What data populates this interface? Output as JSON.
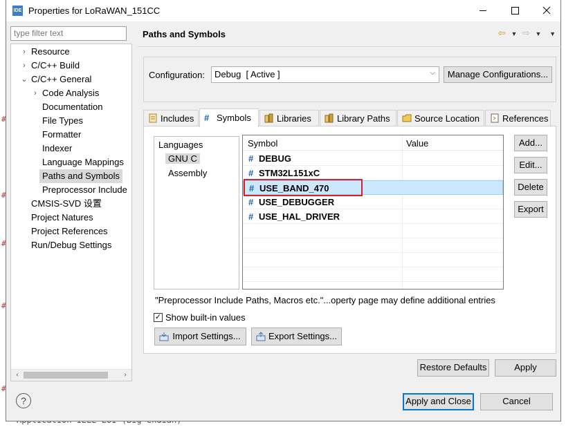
{
  "window": {
    "title": "Properties for LoRaWAN_151CC",
    "icon_text": "IDE",
    "controls": [
      "minimize-icon",
      "maximize-icon",
      "close-icon"
    ]
  },
  "background": {
    "bottom_text": "Application IEEE-EUI (Big endian)"
  },
  "filter": {
    "placeholder": "type filter text"
  },
  "tree": {
    "items": [
      {
        "label": "Resource",
        "level": 1,
        "arrow": "›"
      },
      {
        "label": "C/C++ Build",
        "level": 1,
        "arrow": "›"
      },
      {
        "label": "C/C++ General",
        "level": 1,
        "arrow": "⌄"
      },
      {
        "label": "Code Analysis",
        "level": 2,
        "arrow": "›"
      },
      {
        "label": "Documentation",
        "level": 2,
        "arrow": ""
      },
      {
        "label": "File Types",
        "level": 2,
        "arrow": ""
      },
      {
        "label": "Formatter",
        "level": 2,
        "arrow": ""
      },
      {
        "label": "Indexer",
        "level": 2,
        "arrow": ""
      },
      {
        "label": "Language Mappings",
        "level": 2,
        "arrow": ""
      },
      {
        "label": "Paths and Symbols",
        "level": 2,
        "arrow": "",
        "selected": true
      },
      {
        "label": "Preprocessor Include",
        "level": 2,
        "arrow": ""
      },
      {
        "label": "CMSIS-SVD 设置",
        "level": 1,
        "arrow": ""
      },
      {
        "label": "Project Natures",
        "level": 1,
        "arrow": ""
      },
      {
        "label": "Project References",
        "level": 1,
        "arrow": ""
      },
      {
        "label": "Run/Debug Settings",
        "level": 1,
        "arrow": ""
      }
    ]
  },
  "header": {
    "title": "Paths and Symbols"
  },
  "config": {
    "label": "Configuration:",
    "value": "Debug  [ Active ]",
    "manage_label": "Manage Configurations..."
  },
  "tabs": [
    {
      "label": "Includes",
      "icon": "includes-icon"
    },
    {
      "label": "Symbols",
      "icon": "hash-icon",
      "active": true
    },
    {
      "label": "Libraries",
      "icon": "libraries-icon"
    },
    {
      "label": "Library Paths",
      "icon": "library-paths-icon"
    },
    {
      "label": "Source Location",
      "icon": "folder-icon"
    },
    {
      "label": "References",
      "icon": "references-icon"
    }
  ],
  "languages": {
    "header": "Languages",
    "items": [
      "GNU C",
      "Assembly"
    ],
    "selected": "GNU C"
  },
  "symbols": {
    "headers": [
      "Symbol",
      "Value"
    ],
    "rows": [
      {
        "name": "DEBUG",
        "value": ""
      },
      {
        "name": "STM32L151xC",
        "value": ""
      },
      {
        "name": "USE_BAND_470",
        "value": "",
        "selected": true
      },
      {
        "name": "USE_DEBUGGER",
        "value": ""
      },
      {
        "name": "USE_HAL_DRIVER",
        "value": ""
      }
    ]
  },
  "side_buttons": {
    "add": "Add...",
    "edit": "Edit...",
    "delete": "Delete",
    "export": "Export"
  },
  "note": "\"Preprocessor Include Paths, Macros etc.\"...operty page may define additional entries",
  "show_builtin": {
    "label": "Show built-in values",
    "checked": true
  },
  "import_label": "Import Settings...",
  "export_settings_label": "Export Settings...",
  "restore_label": "Restore Defaults",
  "apply_label": "Apply",
  "apply_close_label": "Apply and Close",
  "cancel_label": "Cancel",
  "help_icon": "help-icon"
}
